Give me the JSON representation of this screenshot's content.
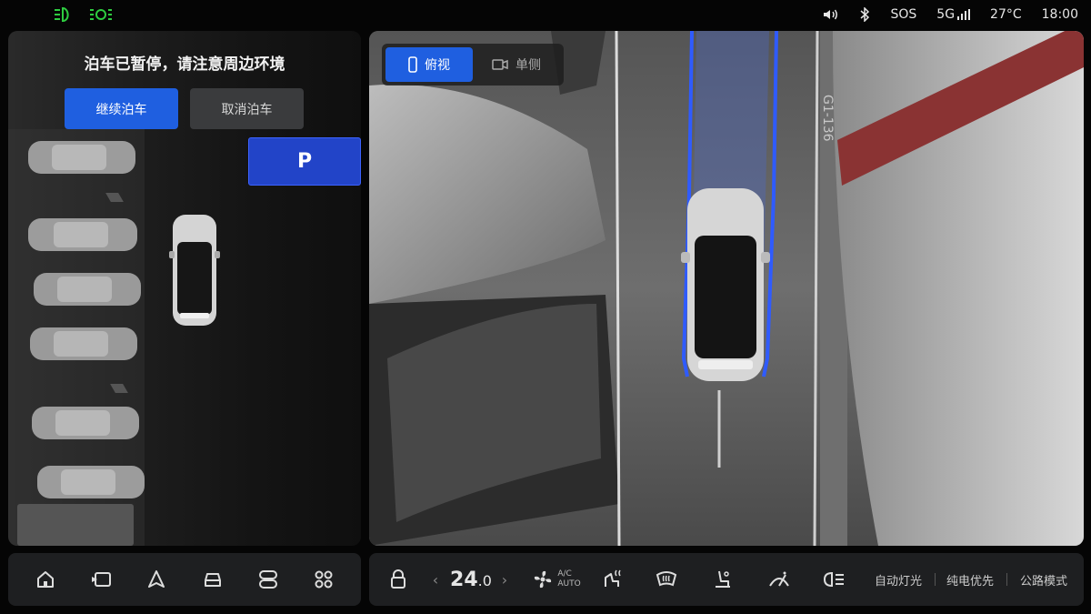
{
  "status_bar": {
    "left_icons": [
      "low-beam-icon",
      "parking-light-icon"
    ],
    "right": {
      "volume_icon": "volume-icon",
      "bluetooth_icon": "bluetooth-icon",
      "sos": "SOS",
      "network": "5G",
      "temperature": "27°C",
      "time": "18:00"
    },
    "indicator_color": "#2ecc40"
  },
  "left_panel": {
    "title": "泊车已暂停，请注意周边环境",
    "continue_button": "继续泊车",
    "cancel_button": "取消泊车",
    "parking_slot_label": "P",
    "accent_color": "#1f5fe0"
  },
  "camera_view": {
    "tabs": [
      {
        "label": "俯视",
        "icon": "phone-icon",
        "active": true
      },
      {
        "label": "单侧",
        "icon": "camera-icon",
        "active": false
      }
    ],
    "pillar_label": "G1-136",
    "trajectory_color": "#2f5bff"
  },
  "bottom_left_nav": [
    {
      "name": "home-icon"
    },
    {
      "name": "media-icon"
    },
    {
      "name": "navigation-icon"
    },
    {
      "name": "car-icon"
    },
    {
      "name": "toggle-icon"
    },
    {
      "name": "apps-grid-icon"
    }
  ],
  "bottom_right": {
    "lock_icon": "lock-icon",
    "temperature_main": "24",
    "temperature_decimal": ".0",
    "fan_icon": "fan-icon",
    "ac_label_top": "A/C",
    "ac_label_bottom": "AUTO",
    "seat_heat_icon": "seat-heat-icon",
    "defrost_icon": "front-defrost-icon",
    "seat_icon": "seat-icon",
    "wiper_icon": "wiper-icon",
    "headlight_icon": "headlight-icon",
    "auto_lights": "自动灯光",
    "ev_priority": "纯电优先",
    "road_mode": "公路模式"
  }
}
